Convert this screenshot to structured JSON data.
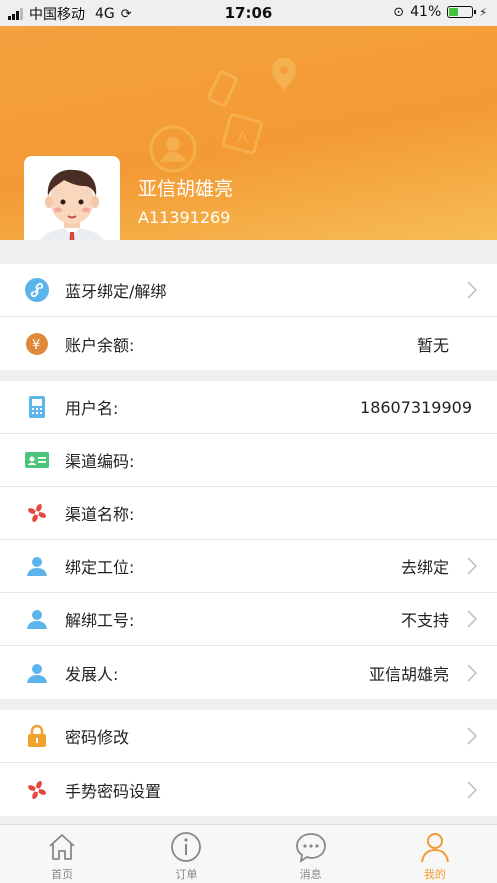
{
  "status_bar": {
    "carrier": "中国移动",
    "network": "4G",
    "time": "17:06",
    "battery": "41%",
    "battery_level": 0.41
  },
  "profile": {
    "name": "亚信胡雄亮",
    "id": "A11391269"
  },
  "section1": [
    {
      "label": "蓝牙绑定/解绑",
      "value": "",
      "icon": "link-icon",
      "color": "#5bb4ea",
      "arrow": true
    },
    {
      "label": "账户余额:",
      "value": "暂无",
      "icon": "yuan-coin-icon",
      "color": "#e0893a",
      "arrow": false
    }
  ],
  "section2": [
    {
      "label": "用户名:",
      "value": "18607319909",
      "icon": "phone-icon",
      "color": "#5bb4ea",
      "arrow": false
    },
    {
      "label": "渠道编码:",
      "value": "",
      "icon": "id-card-icon",
      "color": "#4cc47a",
      "arrow": false
    },
    {
      "label": "渠道名称:",
      "value": "",
      "icon": "pinwheel-icon",
      "color": "#e5473f",
      "arrow": false
    },
    {
      "label": "绑定工位:",
      "value": "去绑定",
      "icon": "person-icon",
      "color": "#5bb4ea",
      "arrow": true
    },
    {
      "label": "解绑工号:",
      "value": "不支持",
      "icon": "person-icon",
      "color": "#5bb4ea",
      "arrow": true
    },
    {
      "label": "发展人:",
      "value": "亚信胡雄亮",
      "icon": "person-icon",
      "color": "#5bb4ea",
      "arrow": true
    }
  ],
  "section3": [
    {
      "label": "密码修改",
      "value": "",
      "icon": "lock-icon",
      "color": "#f0a22e",
      "arrow": true
    },
    {
      "label": "手势密码设置",
      "value": "",
      "icon": "pinwheel-icon",
      "color": "#e5473f",
      "arrow": true
    }
  ],
  "tabs": [
    {
      "label": "首页",
      "icon": "home-icon",
      "active": false
    },
    {
      "label": "订单",
      "icon": "info-icon",
      "active": false
    },
    {
      "label": "消息",
      "icon": "chat-icon",
      "active": false
    },
    {
      "label": "我的",
      "icon": "user-icon",
      "active": true
    }
  ],
  "colors": {
    "accent": "#f39a34",
    "header_start": "#f5a13f",
    "header_end": "#f7bd55"
  }
}
